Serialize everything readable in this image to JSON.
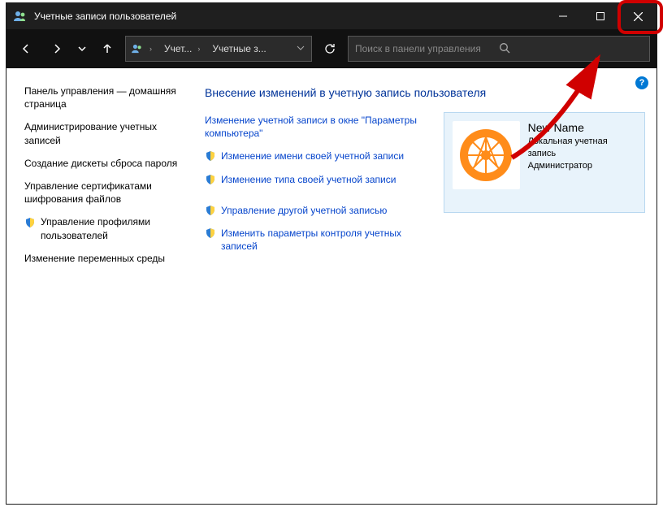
{
  "titlebar": {
    "title": "Учетные записи пользователей"
  },
  "address": {
    "seg1": "Учет...",
    "seg2": "Учетные з..."
  },
  "search": {
    "placeholder": "Поиск в панели управления"
  },
  "sidebar": {
    "items": [
      {
        "label": "Панель управления — домашняя страница",
        "shield": false
      },
      {
        "label": "Администрирование учетных записей",
        "shield": false
      },
      {
        "label": "Создание дискеты сброса пароля",
        "shield": false
      },
      {
        "label": "Управление сертификатами шифрования файлов",
        "shield": false
      },
      {
        "label": "Управление профилями пользователей",
        "shield": true
      },
      {
        "label": "Изменение переменных среды",
        "shield": false
      }
    ]
  },
  "main": {
    "heading": "Внесение изменений в учетную запись пользователя",
    "group1": [
      {
        "label": "Изменение учетной записи в окне \"Параметры компьютера\"",
        "shield": false
      },
      {
        "label": "Изменение имени своей учетной записи",
        "shield": true
      },
      {
        "label": "Изменение типа своей учетной записи",
        "shield": true
      }
    ],
    "group2": [
      {
        "label": "Управление другой учетной записью",
        "shield": true
      },
      {
        "label": "Изменить параметры контроля учетных записей",
        "shield": true
      }
    ]
  },
  "user": {
    "name": "New Name",
    "line1": "Локальная учетная запись",
    "line2": "Администратор"
  }
}
